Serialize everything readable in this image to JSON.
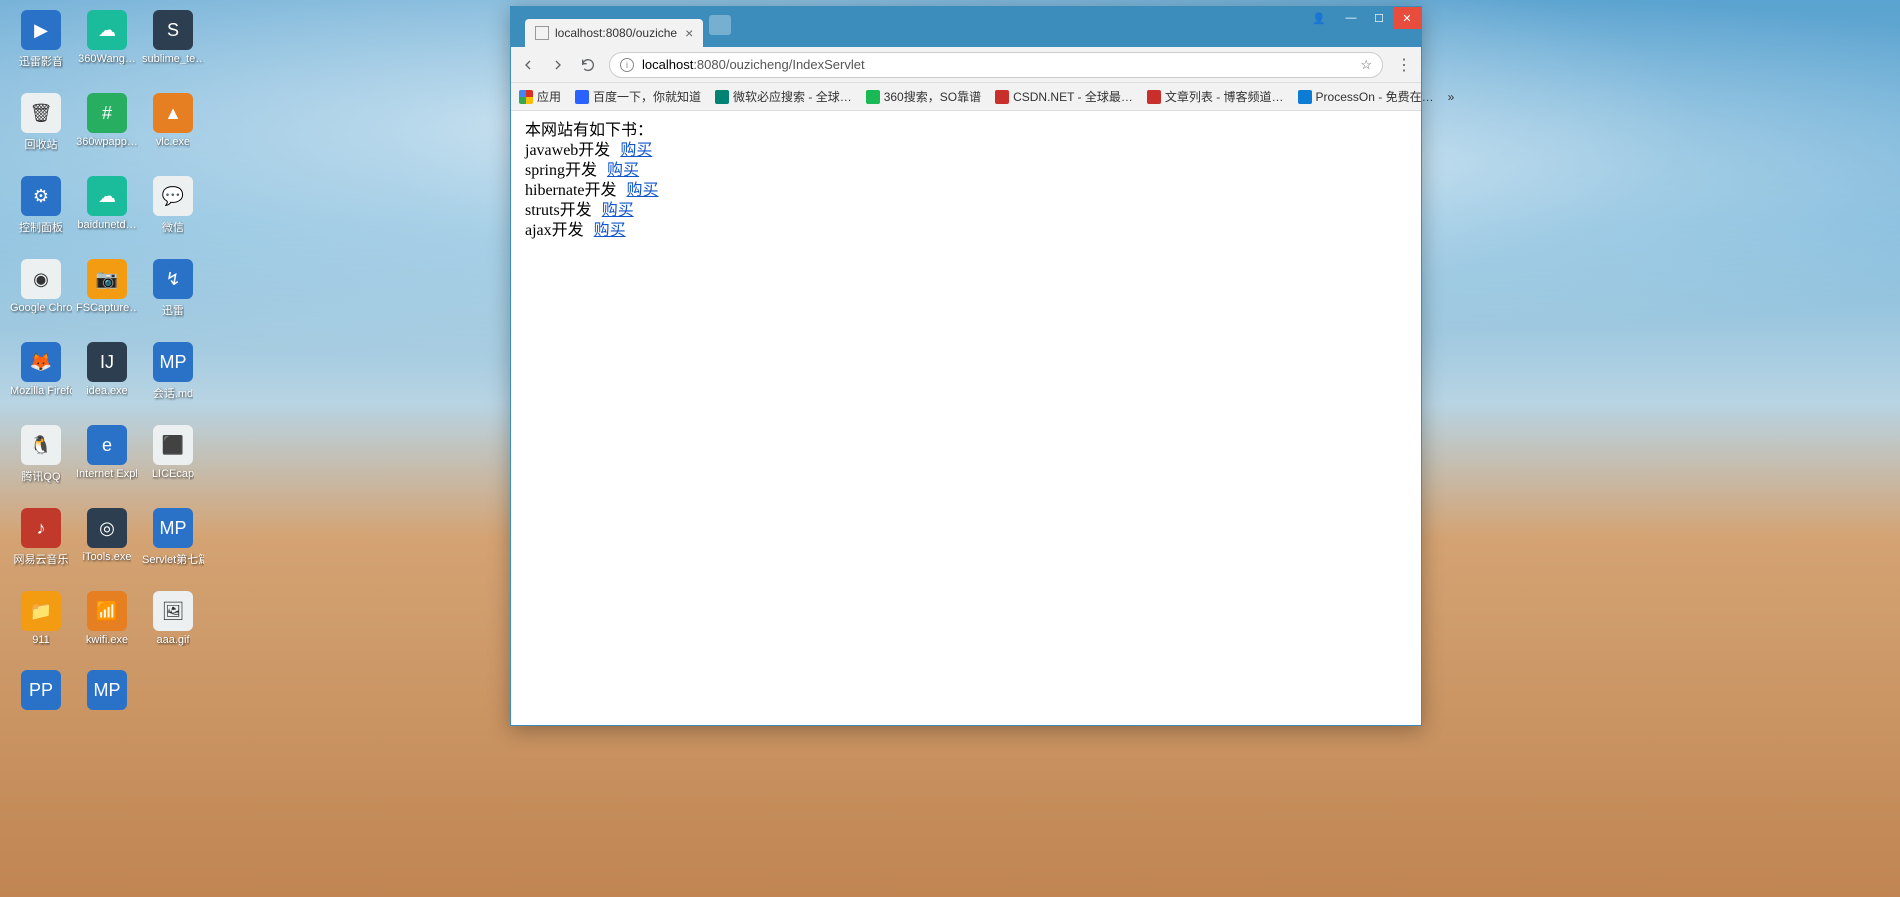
{
  "desktop": {
    "icons": [
      {
        "label": "迅雷影音",
        "color": "ico-blue",
        "glyph": "▶"
      },
      {
        "label": "360Wang…",
        "color": "ico-cyan",
        "glyph": "☁"
      },
      {
        "label": "sublime_te…",
        "color": "ico-dark",
        "glyph": "S"
      },
      {
        "label": "回收站",
        "color": "ico-white",
        "glyph": "🗑"
      },
      {
        "label": "360wpapp…",
        "color": "ico-green",
        "glyph": "#"
      },
      {
        "label": "vlc.exe",
        "color": "ico-orange",
        "glyph": "▲"
      },
      {
        "label": "控制面板",
        "color": "ico-blue",
        "glyph": "⚙"
      },
      {
        "label": "baidunetd…",
        "color": "ico-cyan",
        "glyph": "☁"
      },
      {
        "label": "微信",
        "color": "ico-white",
        "glyph": "💬"
      },
      {
        "label": "Google Chrome",
        "color": "ico-white",
        "glyph": "◉"
      },
      {
        "label": "FSCapture…",
        "color": "ico-yellow",
        "glyph": "📷"
      },
      {
        "label": "迅雷",
        "color": "ico-blue",
        "glyph": "↯"
      },
      {
        "label": "Mozilla Firefox",
        "color": "ico-blue",
        "glyph": "🦊"
      },
      {
        "label": "idea.exe",
        "color": "ico-dark",
        "glyph": "IJ"
      },
      {
        "label": "会话.md",
        "color": "ico-blue",
        "glyph": "MP"
      },
      {
        "label": "腾讯QQ",
        "color": "ico-white",
        "glyph": "🐧"
      },
      {
        "label": "Internet Explorer",
        "color": "ico-blue",
        "glyph": "e"
      },
      {
        "label": "LICEcap",
        "color": "ico-white",
        "glyph": "⬛"
      },
      {
        "label": "网易云音乐",
        "color": "ico-red",
        "glyph": "♪"
      },
      {
        "label": "iTools.exe",
        "color": "ico-dark",
        "glyph": "◎"
      },
      {
        "label": "Servlet第七篇【Cooki…",
        "color": "ico-blue",
        "glyph": "MP"
      },
      {
        "label": "911",
        "color": "ico-yellow",
        "glyph": "📁"
      },
      {
        "label": "kwifi.exe",
        "color": "ico-orange",
        "glyph": "📶"
      },
      {
        "label": "aaa.gif",
        "color": "ico-white",
        "glyph": "🖼"
      },
      {
        "label": "",
        "color": "ico-blue",
        "glyph": "PP"
      },
      {
        "label": "",
        "color": "ico-blue",
        "glyph": "MP"
      }
    ]
  },
  "chrome": {
    "tab_title": "localhost:8080/ouziche",
    "url_host": "localhost",
    "url_port_path": ":8080/ouzicheng/IndexServlet",
    "bookmarks": [
      {
        "label": "应用",
        "color": "#d93025"
      },
      {
        "label": "百度一下，你就知道",
        "color": "#2962ff"
      },
      {
        "label": "微软必应搜索 - 全球…",
        "color": "#008373"
      },
      {
        "label": "360搜索，SO靠谱",
        "color": "#19b955"
      },
      {
        "label": "CSDN.NET - 全球最…",
        "color": "#c9302c"
      },
      {
        "label": "文章列表 - 博客频道…",
        "color": "#c9302c"
      },
      {
        "label": "ProcessOn - 免费在…",
        "color": "#0c7cd5"
      }
    ],
    "more": "»"
  },
  "page": {
    "header": "本网站有如下书：",
    "link_text": "购买",
    "books": [
      {
        "name": "javaweb开发"
      },
      {
        "name": "spring开发"
      },
      {
        "name": "hibernate开发"
      },
      {
        "name": "struts开发"
      },
      {
        "name": "ajax开发"
      }
    ]
  }
}
